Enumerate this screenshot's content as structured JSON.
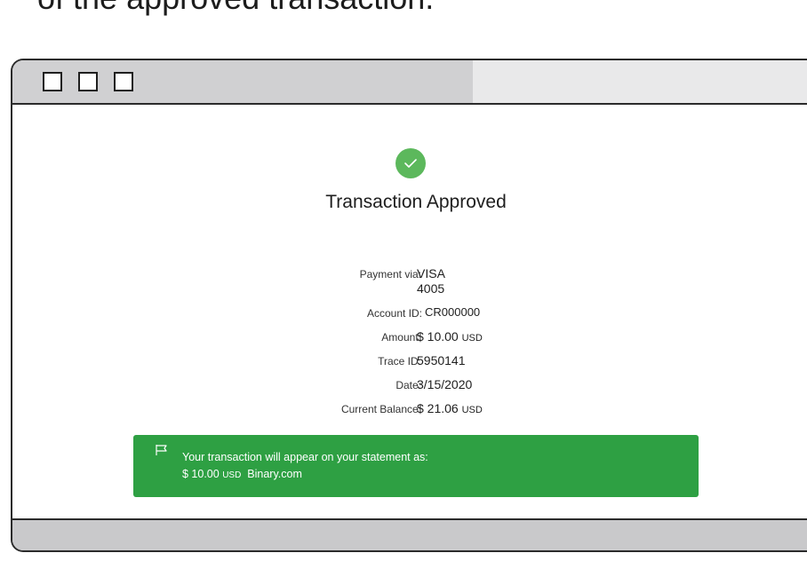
{
  "caption": "of the approved transaction.",
  "window": {
    "buttons": [
      "minimize",
      "maximize",
      "close"
    ]
  },
  "receipt": {
    "title": "Transaction Approved",
    "payment_label": "Payment via:",
    "payment_card": "VISA",
    "payment_last4": "4005",
    "account_label": "Account ID:",
    "account_value": "CR000000",
    "amount_label": "Amount:",
    "amount_value": "$ 10.00",
    "amount_currency": "USD",
    "trace_label": "Trace ID:",
    "trace_value": "5950141",
    "date_label": "Date:",
    "date_value": "3/15/2020",
    "balance_label": "Current Balance:",
    "balance_value": "$ 21.06",
    "balance_currency": "USD"
  },
  "banner": {
    "icon": "flag-icon",
    "line1": "Your transaction will appear on your statement as:",
    "amount": "$ 10.00",
    "currency": "USD",
    "merchant": "Binary.com"
  },
  "colors": {
    "success_green": "#5cb85c",
    "banner_green": "#2ea043",
    "chrome_gray": "#d0d0d2",
    "border": "#2b2b2b"
  }
}
